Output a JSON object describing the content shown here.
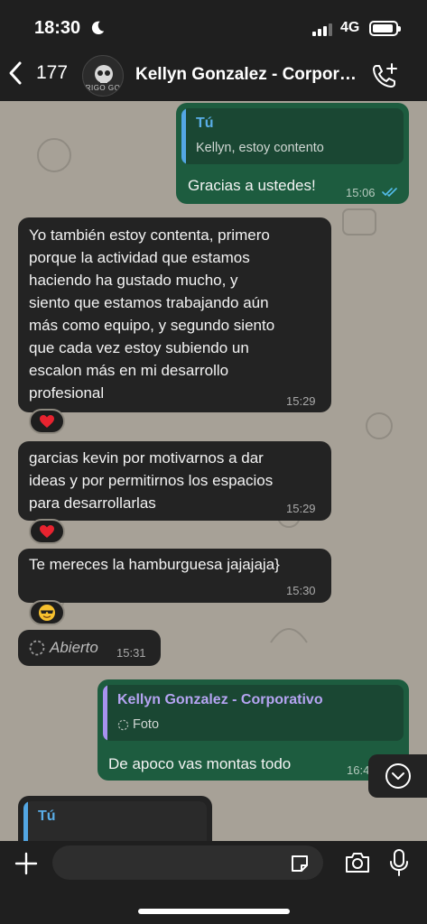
{
  "status_bar": {
    "time": "18:30",
    "network": "4G"
  },
  "header": {
    "back_count": "177",
    "contact_name": "Kellyn Gonzalez - Corporativo",
    "avatar_text": "RIGO GO"
  },
  "messages": [
    {
      "id": "m1",
      "direction": "out",
      "quote_author": "Tú",
      "quote_text": "Kellyn, estoy contento",
      "text": "Gracias a ustedes!",
      "time": "15:06",
      "read": true
    },
    {
      "id": "m2",
      "direction": "in",
      "lines": [
        "Yo también estoy contenta, primero",
        "porque la actividad que estamos",
        "haciendo ha gustado mucho, y",
        "siento que estamos trabajando aún",
        "más como equipo, y segundo siento",
        "que cada vez estoy subiendo un",
        "escalon más en mi desarrollo",
        "profesional"
      ],
      "time": "15:29",
      "reaction": "heart"
    },
    {
      "id": "m3",
      "direction": "in",
      "lines": [
        "garcias kevin por motivarnos a dar",
        "ideas y por permitirnos los espacios",
        "para desarrollarlas"
      ],
      "time": "15:29",
      "reaction": "heart"
    },
    {
      "id": "m4",
      "direction": "in",
      "text": "Te mereces la hamburguesa jajajaja}",
      "time": "15:30",
      "reaction": "sunglasses"
    },
    {
      "id": "m5",
      "direction": "in",
      "text": "Abierto",
      "time": "15:31",
      "type": "view-once-opened"
    },
    {
      "id": "m6",
      "direction": "out",
      "quote_author": "Kellyn Gonzalez - Corporativo",
      "quote_text": "Foto",
      "text": "De apoco vas montas todo",
      "time": "16:4"
    },
    {
      "id": "m7",
      "direction": "out",
      "quote_author": "Tú"
    }
  ],
  "composer": {
    "placeholder": ""
  },
  "icons": {
    "back": "chevron-left-icon",
    "add_call": "add-call-icon",
    "plus": "plus-icon",
    "sticker": "sticker-icon",
    "camera": "camera-icon",
    "mic": "microphone-icon",
    "scroll": "scroll-down-icon"
  },
  "colors": {
    "outgoing_bubble": "#1d5c3f",
    "incoming_bubble": "#232323",
    "quote_blue": "#53a7e4",
    "quote_purple": "#a892ef",
    "read_ticks": "#53bdeb"
  }
}
